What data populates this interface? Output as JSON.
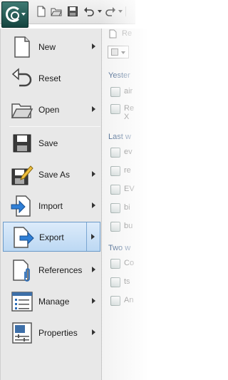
{
  "menu": {
    "items": [
      {
        "label": "New",
        "has_submenu": true,
        "icon": "new-icon"
      },
      {
        "label": "Reset",
        "has_submenu": false,
        "icon": "reset-icon"
      },
      {
        "label": "Open",
        "has_submenu": true,
        "icon": "open-folder-icon"
      },
      {
        "label": "Save",
        "has_submenu": false,
        "icon": "save-icon"
      },
      {
        "label": "Save As",
        "has_submenu": true,
        "icon": "save-as-icon"
      },
      {
        "label": "Import",
        "has_submenu": true,
        "icon": "import-icon"
      },
      {
        "label": "Export",
        "has_submenu": true,
        "icon": "export-icon",
        "active": true
      },
      {
        "label": "References",
        "has_submenu": true,
        "icon": "references-icon"
      },
      {
        "label": "Manage",
        "has_submenu": true,
        "icon": "manage-icon"
      },
      {
        "label": "Properties",
        "has_submenu": true,
        "icon": "properties-icon"
      }
    ]
  },
  "recent": {
    "top_label": "Re",
    "groups": [
      {
        "label": "Yester",
        "docs": [
          "air",
          "Re",
          "X"
        ]
      },
      {
        "label": "Last w",
        "docs": [
          "ev",
          "re",
          "EV",
          "bi",
          "bu"
        ]
      },
      {
        "label": "Two w",
        "docs": [
          "Co",
          "ts",
          "An"
        ]
      }
    ]
  },
  "colors": {
    "app_button": "#2b5f59",
    "active_item": "#bcd8f3",
    "group_header": "#2c4f7c"
  }
}
